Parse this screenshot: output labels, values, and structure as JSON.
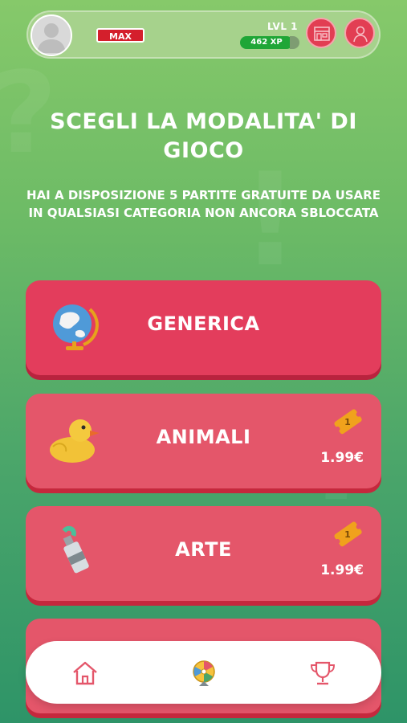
{
  "header": {
    "username": "MAX",
    "level": "LVL 1",
    "xp": "462 XP"
  },
  "main": {
    "title": "SCEGLI LA MODALITA' DI GIOCO",
    "subtitle": "HAI A DISPOSIZIONE 5 PARTITE GRATUITE DA USARE IN QUALSIASI CATEGORIA NON ANCORA SBLOCCATA"
  },
  "categories": [
    {
      "label": "Generica",
      "icon": "globe-icon"
    },
    {
      "label": "Animali",
      "icon": "duck-icon",
      "ticket": "1",
      "price": "1.99€"
    },
    {
      "label": "Arte",
      "icon": "paint-tube-icon",
      "ticket": "1",
      "price": "1.99€"
    }
  ],
  "nav": {
    "items": [
      "home-icon",
      "wheel-icon",
      "trophy-icon"
    ]
  },
  "colors": {
    "card_generic": "#e33d5c",
    "card_locked": "#e4566a",
    "xp_bar": "#1fa637",
    "username_badge": "#d41f2c"
  }
}
